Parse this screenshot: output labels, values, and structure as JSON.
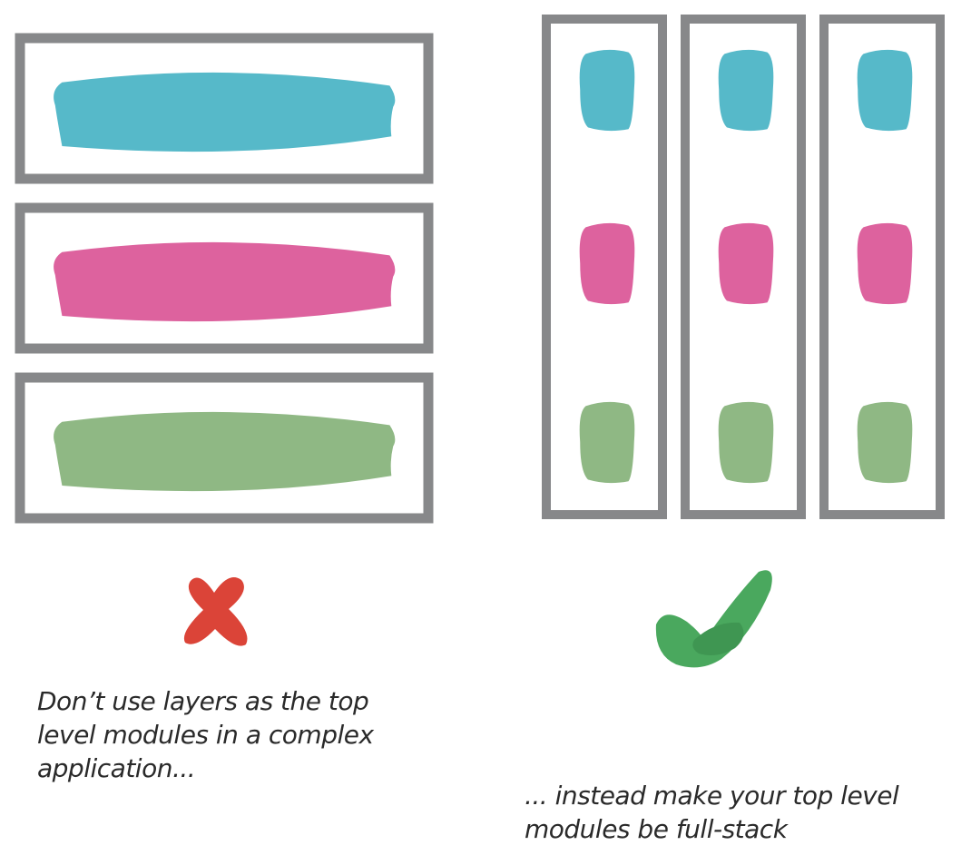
{
  "colors": {
    "frame": "#87888a",
    "cyan": "#56b9c9",
    "pink": "#dd629e",
    "green": "#8fb884",
    "cross": "#db4438",
    "check": "#4aa85e",
    "check_shade": "#3f9652",
    "text": "#2a2a2a"
  },
  "left": {
    "layers": [
      {
        "color_key": "cyan"
      },
      {
        "color_key": "pink"
      },
      {
        "color_key": "green"
      }
    ],
    "verdict_icon": "cross-icon",
    "caption_lines": [
      "Don’t use layers as the top",
      "level modules in a complex",
      "application..."
    ]
  },
  "right": {
    "stacks": [
      {
        "cells": [
          "cyan",
          "pink",
          "green"
        ]
      },
      {
        "cells": [
          "cyan",
          "pink",
          "green"
        ]
      },
      {
        "cells": [
          "cyan",
          "pink",
          "green"
        ]
      }
    ],
    "verdict_icon": "check-icon",
    "caption_lines": [
      "... instead make your top level",
      "modules be full-stack"
    ]
  }
}
